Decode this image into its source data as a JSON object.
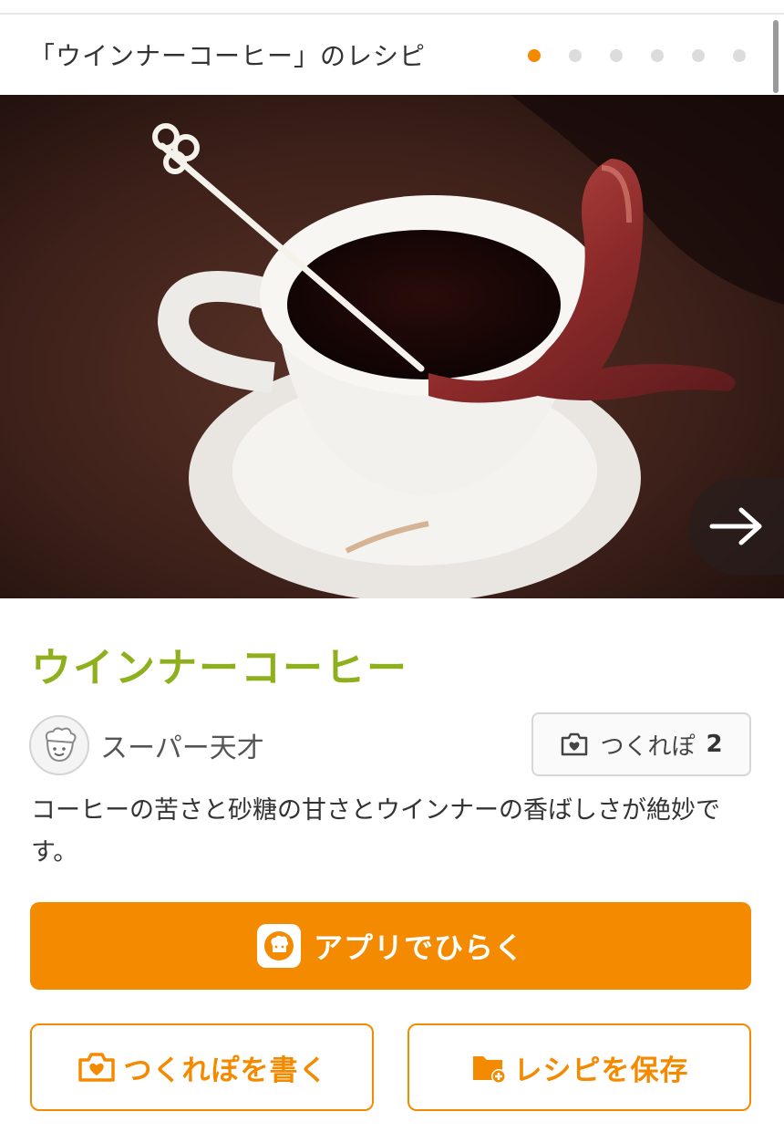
{
  "header": {
    "title": "「ウインナーコーヒー」のレシピ",
    "slide_count": 6,
    "active_slide": 0
  },
  "recipe": {
    "title": "ウインナーコーヒー",
    "author": "スーパー天才",
    "tsukurepo_label": "つくれぽ",
    "tsukurepo_count": "2",
    "description": "コーヒーの苦さと砂糖の甘さとウインナーの香ばしさが絶妙です。"
  },
  "actions": {
    "open_app": "アプリでひらく",
    "write_tsukurepo": "つくれぽを書く",
    "save_recipe": "レシピを保存"
  },
  "colors": {
    "accent": "#f48a00",
    "title_green": "#8fb01d"
  },
  "icons": {
    "next": "arrow-right-icon",
    "avatar": "chef-hat-face-icon",
    "tsukurepo": "camera-heart-icon",
    "app": "cookpad-app-icon",
    "save": "folder-plus-icon"
  }
}
